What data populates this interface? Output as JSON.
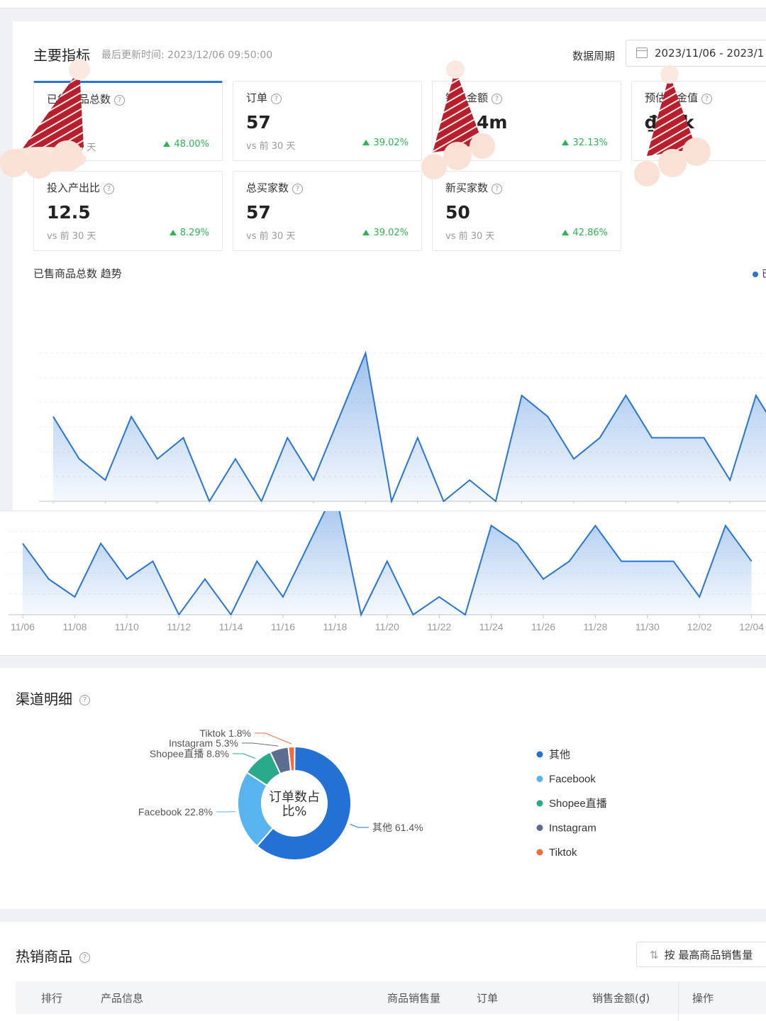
{
  "overview": {
    "title": "主要指标",
    "updated": "最后更新时间: 2023/12/06 09:50:00",
    "period_label": "数据周期",
    "date_range": "2023/11/06  -  2023/1"
  },
  "metrics": [
    {
      "label": "已售商品总数",
      "value": "",
      "compare": "vs 前 30 天",
      "change": "48.00%"
    },
    {
      "label": "订单",
      "value": "57",
      "compare": "vs 前 30 天",
      "change": "39.02%"
    },
    {
      "label": "销售金额",
      "value": "4m",
      "compare": "",
      "change": "32.13%"
    },
    {
      "label": "预估佣金值",
      "value": "₫ .1k",
      "compare": "",
      "change": ""
    },
    {
      "label": "投入产出比",
      "value": "12.5",
      "compare": "vs 前 30 天",
      "change": "8.29%"
    },
    {
      "label": "总买家数",
      "value": "57",
      "compare": "vs 前 30 天",
      "change": "39.02%"
    },
    {
      "label": "新买家数",
      "value": "50",
      "compare": "vs 前 30 天",
      "change": "42.86%"
    }
  ],
  "trend": {
    "title": "已售商品总数 趋势",
    "legend_partial": "已"
  },
  "chart_data": {
    "type": "area",
    "title": "已售商品总数 趋势",
    "x": [
      "11/06",
      "11/07",
      "11/08",
      "11/09",
      "11/10",
      "11/11",
      "11/12",
      "11/13",
      "11/14",
      "11/15",
      "11/16",
      "11/17",
      "11/18",
      "11/19",
      "11/20",
      "11/21",
      "11/22",
      "11/23",
      "11/24",
      "11/25",
      "11/26",
      "11/27",
      "11/28",
      "11/29",
      "11/30",
      "12/01",
      "12/02",
      "12/03",
      "12/04"
    ],
    "x_tick_labels": [
      "11/06",
      "11/08",
      "11/10",
      "11/12",
      "11/14",
      "11/16",
      "11/18",
      "11/20",
      "11/22",
      "11/24",
      "11/26",
      "11/28",
      "11/30",
      "12/02",
      "12/04"
    ],
    "series": [
      {
        "values": [
          4,
          2,
          1,
          4,
          2,
          3,
          0,
          2,
          0,
          3,
          1,
          4,
          7,
          0,
          3,
          0,
          1,
          0,
          5,
          4,
          2,
          3,
          5,
          3,
          3,
          3,
          1,
          5,
          3
        ]
      }
    ],
    "ylim": [
      0,
      7
    ],
    "grid": true,
    "color": "#2775d8"
  },
  "channels": {
    "title": "渠道明细",
    "center_label": "订单数占比%",
    "colors": [
      "#2471d6",
      "#57b4ee",
      "#2aaa8a",
      "#5c6e8f",
      "#ef6d3a"
    ],
    "items": [
      {
        "name": "其他",
        "pct": 61.4,
        "label": "其他 61.4%"
      },
      {
        "name": "Facebook",
        "pct": 22.8,
        "label": "Facebook 22.8%"
      },
      {
        "name": "Shopee直播",
        "pct": 8.8,
        "label": "Shopee直播 8.8%"
      },
      {
        "name": "Instagram",
        "pct": 5.3,
        "label": "Instagram 5.3%"
      },
      {
        "name": "Tiktok",
        "pct": 1.8,
        "label": "Tiktok 1.8%"
      }
    ]
  },
  "hot": {
    "title": "热销商品",
    "sort_label": "按 最高商品销售量",
    "columns": [
      "排行",
      "产品信息",
      "商品销售量",
      "订单",
      "销售金额(₫)",
      "操作"
    ]
  }
}
